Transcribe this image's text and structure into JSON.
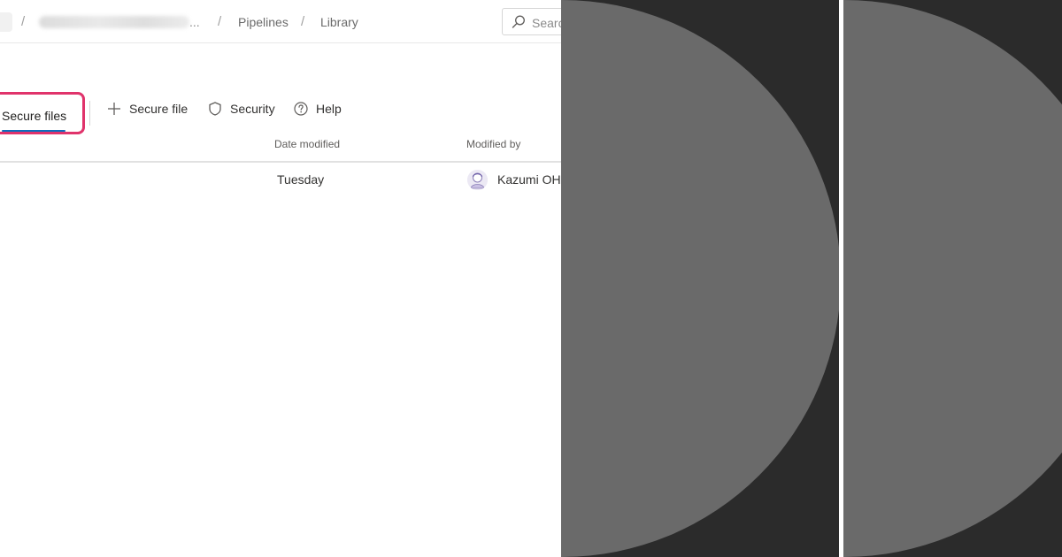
{
  "breadcrumb": {
    "separator": "/",
    "ellipsis": "...",
    "pipelines": "Pipelines",
    "library": "Library"
  },
  "search": {
    "placeholder": "Search"
  },
  "toolbar": {
    "active_tab": "Secure files",
    "add_label": "Secure file",
    "security_label": "Security",
    "help_label": "Help"
  },
  "table": {
    "columns": [
      "Date modified",
      "Modified by"
    ],
    "rows": [
      {
        "date_modified": "Tuesday",
        "modified_by": "Kazumi OHIRA"
      }
    ]
  },
  "colors": {
    "highlight": "#e0336b",
    "tab_underline": "#0f6cbd",
    "dark_panel": "#2b2b2b",
    "circle": "#6a6a6a"
  },
  "icons": [
    "search-icon",
    "plus-icon",
    "shield-icon",
    "help-icon",
    "avatar"
  ]
}
